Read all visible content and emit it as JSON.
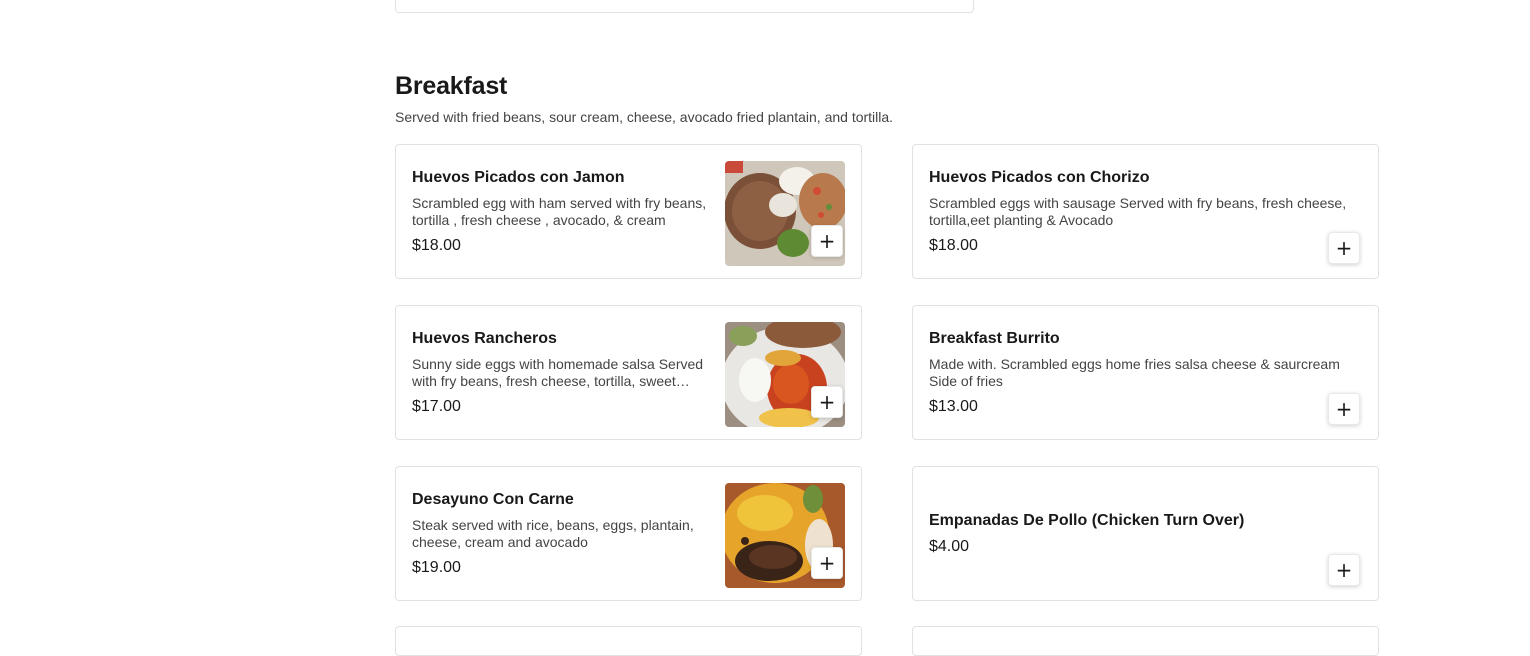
{
  "section": {
    "title": "Breakfast",
    "description": "Served with fried beans, sour cream, cheese, avocado fried plantain, and tortilla."
  },
  "add_symbol": "+",
  "items": [
    {
      "name": "Huevos Picados con Jamon",
      "description": "Scrambled egg with ham served with fry beans, tortilla , fresh cheese , avocado, & cream",
      "price": "$18.00",
      "has_image": true
    },
    {
      "name": "Huevos Picados con Chorizo",
      "description": "Scrambled eggs with sausage Served with fry beans, fresh cheese, tortilla,eet planting & Avocado",
      "price": "$18.00",
      "has_image": false
    },
    {
      "name": "Huevos Rancheros",
      "description": "Sunny side eggs with homemade salsa Served with fry beans, fresh cheese, tortilla, sweet plantain & avocado",
      "price": "$17.00",
      "has_image": true
    },
    {
      "name": "Breakfast Burrito",
      "description": "Made with. Scrambled eggs home fries salsa cheese & saurcream Side of fries",
      "price": "$13.00",
      "has_image": false
    },
    {
      "name": "Desayuno Con Carne",
      "description": "Steak served with rice, beans, eggs, plantain, cheese, cream and avocado",
      "price": "$19.00",
      "has_image": true
    },
    {
      "name": "Empanadas De Pollo (Chicken Turn Over)",
      "description": "",
      "price": "$4.00",
      "has_image": false
    }
  ]
}
